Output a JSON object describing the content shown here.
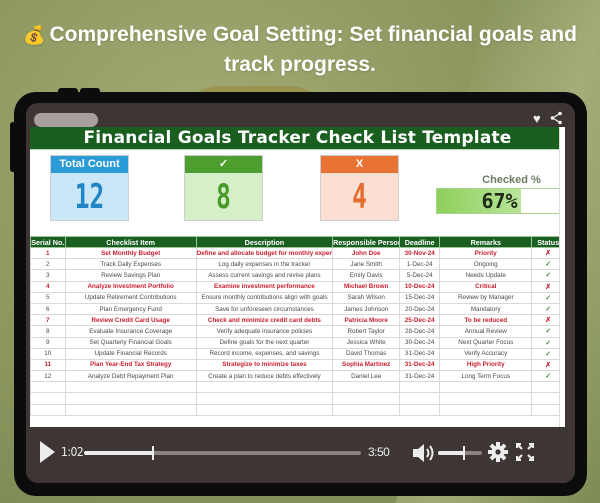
{
  "headline": {
    "icon": "money-bag-icon",
    "emoji": "💰",
    "text": "Comprehensive Goal Setting: Set financial goals and track progress."
  },
  "topbar": {
    "icons": [
      "heart-icon",
      "share-icon"
    ],
    "heart_glyph": "♥"
  },
  "sheet": {
    "title": "Financial Goals Tracker Check List Template",
    "kpis": {
      "total": {
        "label": "Total Count",
        "value": "12",
        "color": "#2a9bd6"
      },
      "checked": {
        "label": "✓",
        "value": "8",
        "color": "#4c9e2e"
      },
      "unchecked": {
        "label": "X",
        "value": "4",
        "color": "#e87333"
      }
    },
    "checked_pct": {
      "label": "Checked %",
      "value_text": "67%",
      "fraction": 0.67
    },
    "columns": [
      "Serial No.",
      "Checklist Item",
      "Description",
      "Responsible Person",
      "Deadline",
      "Remarks",
      "Status"
    ],
    "rows": [
      {
        "serial": "1",
        "item": "Set Monthly Budget",
        "description": "Define and allocate budget for monthly expenses",
        "person": "John Doe",
        "deadline": "30-Nov-24",
        "remarks": "Priority",
        "status": "✗",
        "highlight": true
      },
      {
        "serial": "2",
        "item": "Track Daily Expenses",
        "description": "Log daily expenses in the tracker",
        "person": "Jane Smith",
        "deadline": "1-Dec-24",
        "remarks": "Ongoing",
        "status": "✓",
        "highlight": false
      },
      {
        "serial": "3",
        "item": "Review Savings Plan",
        "description": "Assess current savings and revise plans",
        "person": "Emily Davis",
        "deadline": "5-Dec-24",
        "remarks": "Needs Update",
        "status": "✓",
        "highlight": false
      },
      {
        "serial": "4",
        "item": "Analyze Investment Portfolio",
        "description": "Examine investment performance",
        "person": "Michael Brown",
        "deadline": "10-Dec-24",
        "remarks": "Critical",
        "status": "✗",
        "highlight": true
      },
      {
        "serial": "5",
        "item": "Update Retirement Contributions",
        "description": "Ensure monthly contributions align with goals",
        "person": "Sarah Wilson",
        "deadline": "15-Dec-24",
        "remarks": "Review by Manager",
        "status": "✓",
        "highlight": false
      },
      {
        "serial": "6",
        "item": "Plan Emergency Fund",
        "description": "Save for unforeseen circumstances",
        "person": "James Johnson",
        "deadline": "20-Dec-24",
        "remarks": "Mandatory",
        "status": "✓",
        "highlight": false
      },
      {
        "serial": "7",
        "item": "Review Credit Card Usage",
        "description": "Check and minimize credit card debts",
        "person": "Patricia Moore",
        "deadline": "25-Dec-24",
        "remarks": "To be reduced",
        "status": "✗",
        "highlight": true
      },
      {
        "serial": "8",
        "item": "Evaluate Insurance Coverage",
        "description": "Verify adequate insurance policies",
        "person": "Robert Taylor",
        "deadline": "28-Dec-24",
        "remarks": "Annual Review",
        "status": "✓",
        "highlight": false
      },
      {
        "serial": "9",
        "item": "Set Quarterly Financial Goals",
        "description": "Define goals for the next quarter",
        "person": "Jessica White",
        "deadline": "30-Dec-24",
        "remarks": "Next Quarter Focus",
        "status": "✓",
        "highlight": false
      },
      {
        "serial": "10",
        "item": "Update Financial Records",
        "description": "Record income, expenses, and savings",
        "person": "David Thomas",
        "deadline": "31-Dec-24",
        "remarks": "Verify Accuracy",
        "status": "✓",
        "highlight": false
      },
      {
        "serial": "11",
        "item": "Plan Year-End Tax Strategy",
        "description": "Strategize to minimize taxes",
        "person": "Sophia Martinez",
        "deadline": "31-Dec-24",
        "remarks": "High Priority",
        "status": "✗",
        "highlight": true
      },
      {
        "serial": "12",
        "item": "Analyze Debt Repayment Plan",
        "description": "Create a plan to reduce debts effectively",
        "person": "Daniel Lee",
        "deadline": "31-Dec-24",
        "remarks": "Long Term Focus",
        "status": "✓",
        "highlight": false
      }
    ],
    "empty_rows": 3
  },
  "player": {
    "current_time": "1:02",
    "duration": "3:50",
    "progress_fraction": 0.25,
    "volume_fraction": 0.6,
    "icons": [
      "play-icon",
      "volume-icon",
      "settings-gear-icon",
      "fullscreen-icon"
    ]
  }
}
